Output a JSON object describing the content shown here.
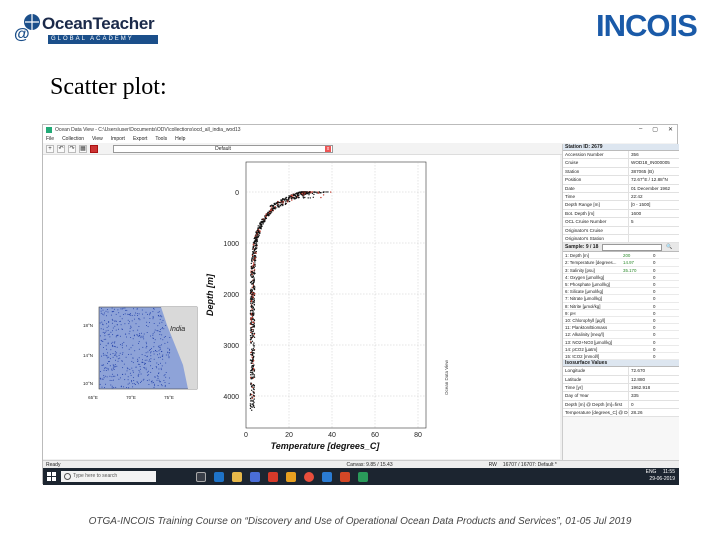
{
  "header": {
    "logo_symbol": "@",
    "logo_title": "OceanTeacher",
    "logo_subtitle": "GLOBAL ACADEMY",
    "right_logo": "INCOIS"
  },
  "slide_title": "Scatter plot:",
  "window": {
    "title": "Ocean Data View - C:\\Users\\user\\Documents\\ODV\\collections\\ocd_all_india_wod13",
    "menu": [
      "File",
      "Collection",
      "View",
      "Import",
      "Export",
      "Tools",
      "Help"
    ],
    "view_name": "Default",
    "controls": [
      "–",
      "▢",
      "✕"
    ]
  },
  "plot": {
    "ylabel": "Depth [m]",
    "xlabel": "Temperature [degrees_C]",
    "yticks": [
      "0",
      "1000",
      "2000",
      "3000",
      "4000"
    ],
    "xticks": [
      "0",
      "20",
      "40",
      "60",
      "80"
    ],
    "watermark": "Ocean Data View",
    "map": {
      "lat_labels": [
        "18°N",
        "14°N",
        "10°N"
      ],
      "lon_labels": [
        "65°E",
        "70°E",
        "75°E"
      ],
      "place": "India"
    }
  },
  "station": {
    "header": "Station ID: 2679",
    "rows": [
      {
        "k": "Accession Number",
        "v": "356"
      },
      {
        "k": "Cruise",
        "v": "WOD18_IN000005"
      },
      {
        "k": "Station",
        "v": "387065 (B)"
      },
      {
        "k": "Position",
        "v": "72.67°E / 12.88°N"
      },
      {
        "k": "Date",
        "v": "01 December 1962"
      },
      {
        "k": "Time",
        "v": "22:42"
      },
      {
        "k": "Depth Range [m]",
        "v": "[0 - 1500]"
      },
      {
        "k": "Bot. Depth [m]",
        "v": "1600"
      },
      {
        "k": "OCL Cruise Number",
        "v": "5"
      },
      {
        "k": "Originator's Cruise",
        "v": ""
      },
      {
        "k": "Originator's Station",
        "v": ""
      }
    ]
  },
  "samples": {
    "header": "Sample: 9 / 18",
    "rows": [
      {
        "k": "1: Depth [m]",
        "v": "200",
        "v2": "0"
      },
      {
        "k": "2: Temperature [degrees...",
        "v": "14.97",
        "v2": "0"
      },
      {
        "k": "3: Salinity [psu]",
        "v": "35.170",
        "v2": "0"
      },
      {
        "k": "4: Oxygen [µmol/kg]",
        "v": "",
        "v2": "0"
      },
      {
        "k": "5: Phosphate [µmol/kg]",
        "v": "",
        "v2": "0"
      },
      {
        "k": "6: Silicate [µmol/kg]",
        "v": "",
        "v2": "0"
      },
      {
        "k": "7: Nitrate [µmol/kg]",
        "v": "",
        "v2": "0"
      },
      {
        "k": "8: Nitrite [µmol/kg]",
        "v": "",
        "v2": "0"
      },
      {
        "k": "9: pH",
        "v": "",
        "v2": "0"
      },
      {
        "k": "10: Chlorophyll [µg/l]",
        "v": "",
        "v2": "0"
      },
      {
        "k": "11: Plankton/Biomass",
        "v": "",
        "v2": "0"
      },
      {
        "k": "12: Alkalinity [meq/l]",
        "v": "",
        "v2": "0"
      },
      {
        "k": "13: NO2+NO3 [µmol/kg]",
        "v": "",
        "v2": "0"
      },
      {
        "k": "14: pCO2 [µatm]",
        "v": "",
        "v2": "0"
      },
      {
        "k": "15: tCO2 [mmol/l]",
        "v": "",
        "v2": "0"
      }
    ]
  },
  "isosurface": {
    "header": "Isosurface Values",
    "rows": [
      {
        "k": "Longitude",
        "v": "72.670"
      },
      {
        "k": "Latitude",
        "v": "12.880"
      },
      {
        "k": "Time [yr]",
        "v": "1962.918"
      },
      {
        "k": "Day of Year",
        "v": "335"
      },
      {
        "k": "Depth [m] @ Depth [m]=first",
        "v": "0"
      },
      {
        "k": "Temperature [degrees_C] @ Depth [m...",
        "v": "28.26"
      }
    ]
  },
  "statusbar": {
    "ready": "Ready",
    "canvas": "Canvas: 9.85 / 15.43",
    "rw": "RW",
    "count": "16707 / 16707: Default *"
  },
  "taskbar": {
    "search_placeholder": "Type here to search",
    "time": "11:55",
    "date": "29-06-2019",
    "lang": "ENG"
  },
  "footer": "OTGA-INCOIS Training Course on “Discovery and Use of Operational Ocean Data Products and Services”, 01-05 Jul 2019"
}
